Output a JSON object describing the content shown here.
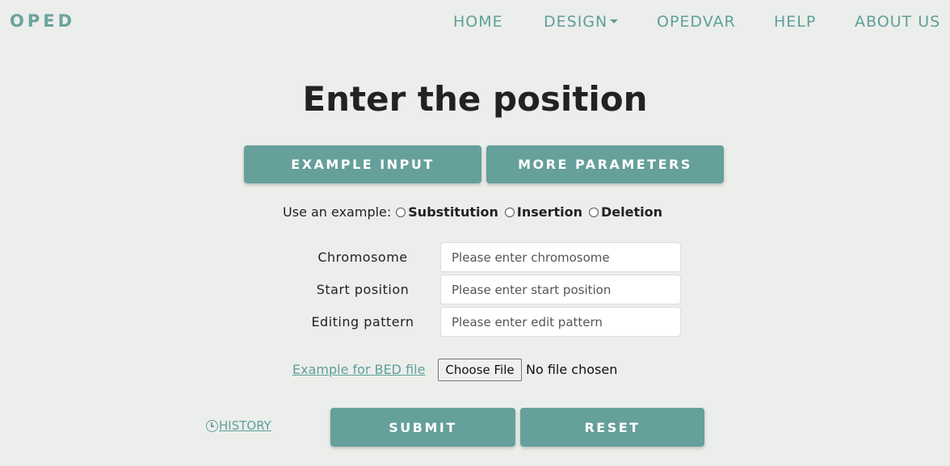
{
  "brand": "OPED",
  "nav": {
    "home": "HOME",
    "design": "DESIGN",
    "opedvar": "OPEDVAR",
    "help": "HELP",
    "about": "ABOUT US"
  },
  "title": "Enter the position",
  "buttons": {
    "example_input": "EXAMPLE INPUT",
    "more_parameters": "MORE PARAMETERS",
    "submit": "SUBMIT",
    "reset": "RESET"
  },
  "examples": {
    "label": "Use an example:",
    "options": [
      "Substitution",
      "Insertion",
      "Deletion"
    ]
  },
  "fields": {
    "chromosome": {
      "label": "Chromosome",
      "placeholder": "Please enter chromosome"
    },
    "start": {
      "label": "Start position",
      "placeholder": "Please enter start position"
    },
    "pattern": {
      "label": "Editing pattern",
      "placeholder": "Please enter edit pattern"
    }
  },
  "bed": {
    "link": "Example for BED file",
    "choose": "Choose File",
    "status": "No file chosen"
  },
  "history": "HISTORY",
  "colors": {
    "accent": "#65a09b",
    "background": "#eceeeb",
    "link": "#5f9f99"
  }
}
